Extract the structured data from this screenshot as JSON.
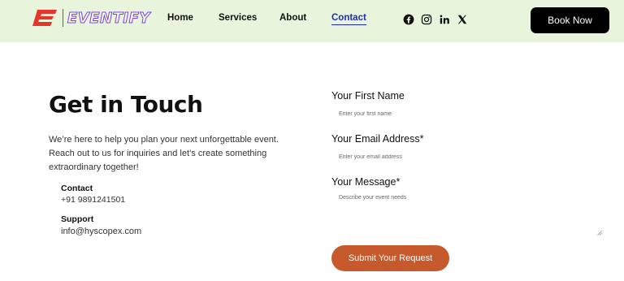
{
  "brand": {
    "name": "EVENTIFY",
    "primary_color": "#e8352b",
    "accent_color": "#7a3fe0"
  },
  "header": {
    "background": "#e8f4dc"
  },
  "nav": {
    "items": [
      {
        "label": "Home",
        "active": false
      },
      {
        "label": "Services",
        "active": false
      },
      {
        "label": "About",
        "active": false
      },
      {
        "label": "Contact",
        "active": true
      }
    ]
  },
  "social": [
    "facebook-icon",
    "instagram-icon",
    "linkedin-icon",
    "x-icon"
  ],
  "cta": {
    "label": "Book Now"
  },
  "hero": {
    "heading": "Get in Touch",
    "intro": "We’re here to help you plan your next unforgettable event. Reach out to us for inquiries and let’s create something extraordinary together!"
  },
  "contact": {
    "title": "Contact",
    "value": "+91 9891241501"
  },
  "support": {
    "title": "Support",
    "value": "info@hyscopex.com"
  },
  "form": {
    "first_name": {
      "label": "Your First Name",
      "placeholder": "Enter your first name",
      "value": ""
    },
    "email": {
      "label": "Your Email Address*",
      "placeholder": "Enter your email address",
      "value": ""
    },
    "message": {
      "label": "Your Message*",
      "placeholder": "Describe your event needs",
      "value": ""
    },
    "submit_label": "Submit Your Request",
    "submit_color": "#c65a2c"
  }
}
